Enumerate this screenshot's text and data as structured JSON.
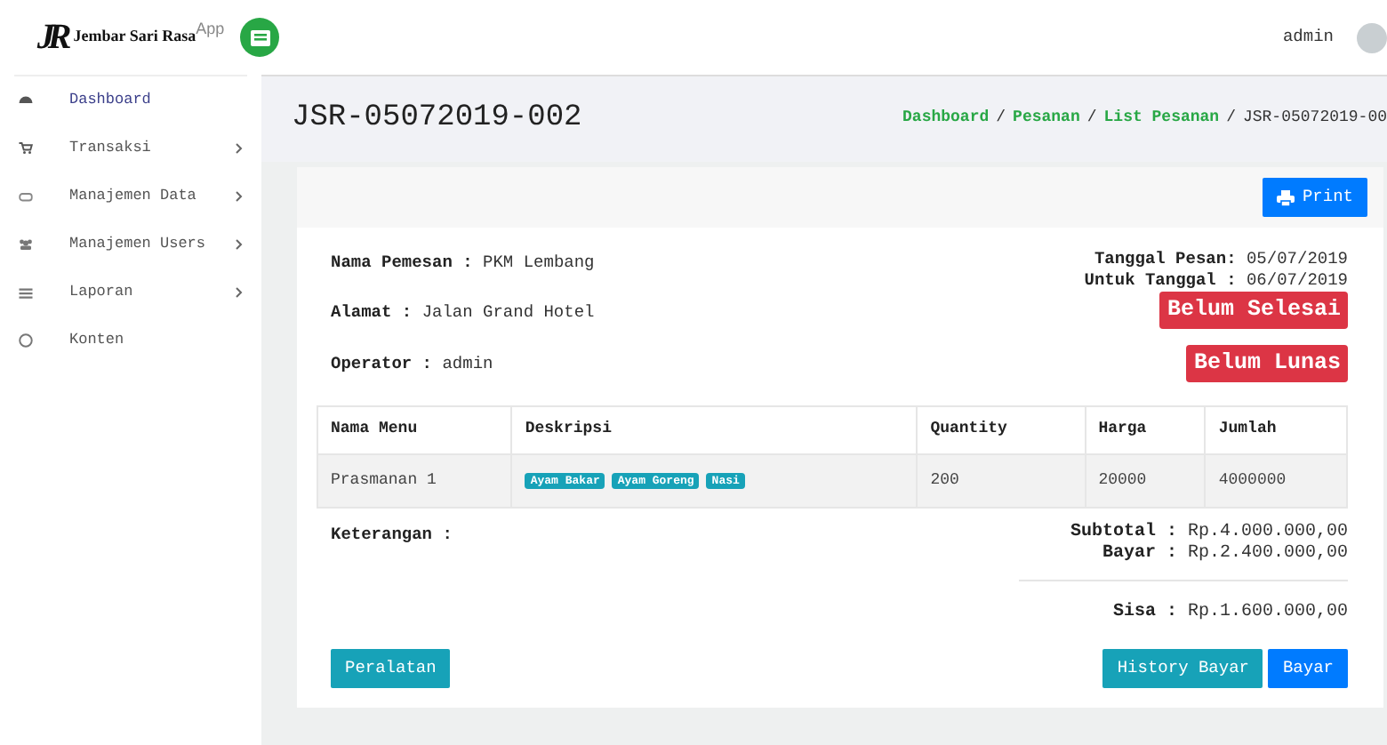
{
  "brand": {
    "mark": "JR",
    "name": "Jembar Sari Rasa$^{App}$"
  },
  "topbar": {
    "user": "admin"
  },
  "sidebar": {
    "items": [
      {
        "label": "Dashboard",
        "expandable": false,
        "selected": true
      },
      {
        "label": "Transaksi",
        "expandable": true,
        "selected": false
      },
      {
        "label": "Manajemen Data",
        "expandable": true,
        "selected": false
      },
      {
        "label": "Manajemen Users",
        "expandable": true,
        "selected": false
      },
      {
        "label": "Laporan",
        "expandable": true,
        "selected": false
      },
      {
        "label": "Konten",
        "expandable": false,
        "selected": false
      }
    ]
  },
  "page": {
    "title": "JSR-05072019-002",
    "breadcrumb": [
      "Dashboard",
      "Pesanan",
      "List Pesanan",
      "JSR-05072019-00"
    ],
    "separator": "/"
  },
  "print_button": "Print",
  "info_left": [
    {
      "label": "Nama Pemesan :",
      "value": "PKM Lembang"
    },
    {
      "label": "Alamat :",
      "value": "Jalan Grand Hotel"
    },
    {
      "label": "Operator :",
      "value": "admin"
    }
  ],
  "info_right": [
    {
      "label": "Tanggal Pesan:",
      "value": "05/07/2019"
    },
    {
      "label": "Untuk Tanggal :",
      "value": "06/07/2019"
    }
  ],
  "status_badges": [
    "Belum Selesai",
    "Belum Lunas"
  ],
  "table": {
    "columns": [
      "Nama Menu",
      "Deskripsi",
      "Quantity",
      "Harga",
      "Jumlah"
    ],
    "rows": [
      {
        "menu": "Prasmanan 1",
        "tags": [
          "Ayam Bakar",
          "Ayam Goreng",
          "Nasi"
        ],
        "quantity": "200",
        "harga": "20000",
        "jumlah": "4000000"
      }
    ]
  },
  "keterangan": "Keterangan :",
  "totals": [
    {
      "label": "Subtotal :",
      "value": "Rp.4.000.000,00"
    },
    {
      "label": "Bayar :",
      "value": "Rp.2.400.000,00"
    }
  ],
  "sisa": {
    "label": "Sisa :",
    "value": "Rp.1.600.000,00"
  },
  "buttons": {
    "left": "Peralatan",
    "right": [
      "History Bayar",
      "Bayar"
    ]
  }
}
